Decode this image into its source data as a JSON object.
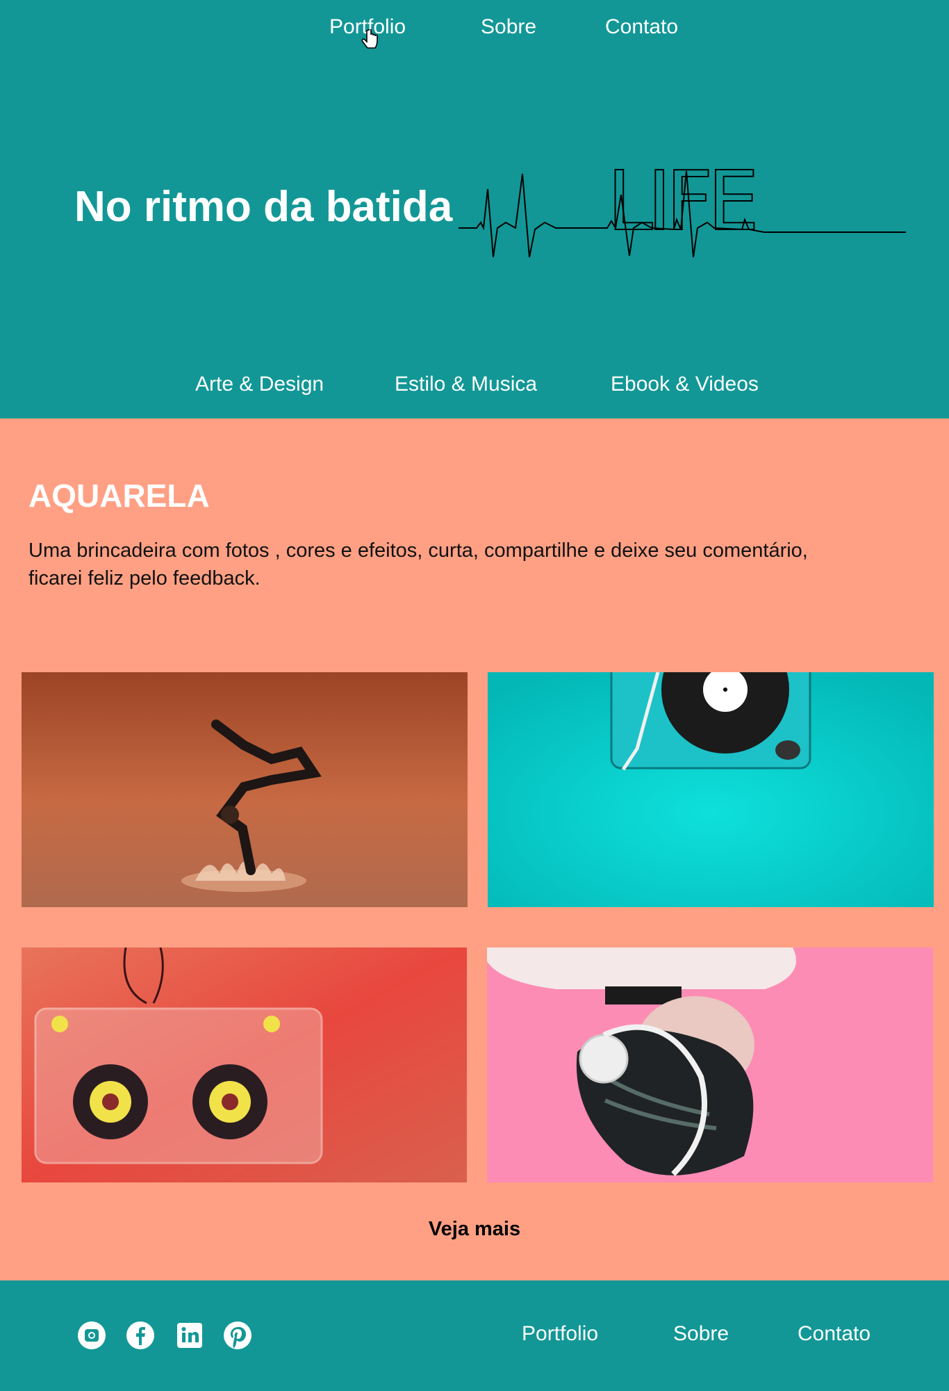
{
  "nav": {
    "items": [
      "Portfolio",
      "Sobre",
      "Contato"
    ]
  },
  "hero": {
    "title": "No ritmo da batida",
    "logo_text": "LIFE"
  },
  "subnav": {
    "items": [
      "Arte & Design",
      "Estilo & Musica",
      "Ebook & Videos"
    ]
  },
  "section": {
    "title": "AQUARELA",
    "description": "Uma brincadeira com fotos , cores e efeitos, curta, compartilhe e deixe seu comentário, ficarei feliz pelo feedback.",
    "more_label": "Veja mais"
  },
  "footer": {
    "social": [
      "instagram-icon",
      "facebook-icon",
      "linkedin-icon",
      "pinterest-icon"
    ],
    "nav": [
      "Portfolio",
      "Sobre",
      "Contato"
    ]
  },
  "colors": {
    "teal": "#129796",
    "salmon": "#ffa084"
  }
}
